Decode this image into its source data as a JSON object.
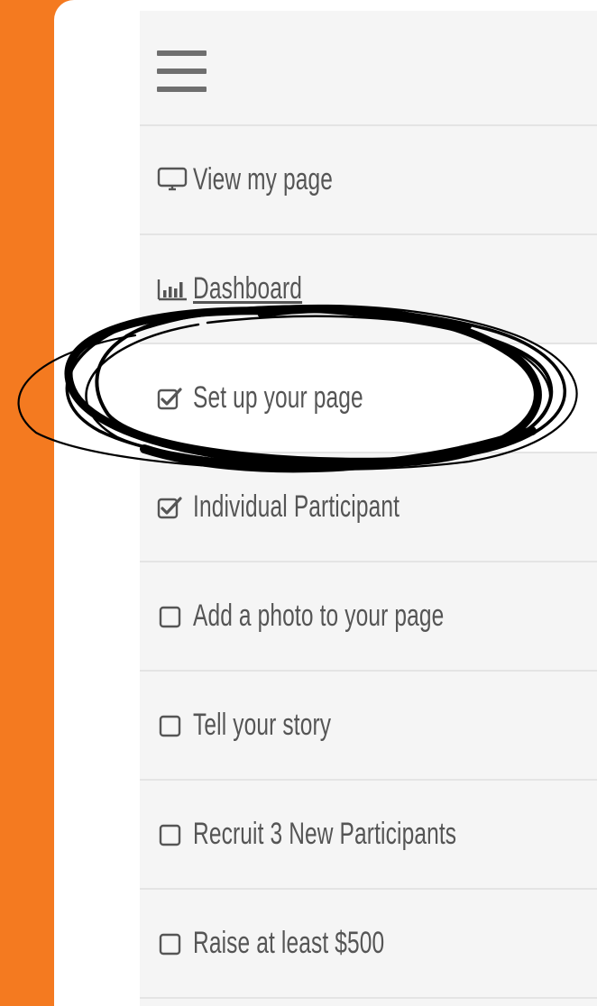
{
  "colors": {
    "accent_orange": "#f47a20",
    "menu_bg": "#f5f5f5",
    "active_bg": "#ffffff",
    "text": "#555555",
    "divider": "#e4e4e4"
  },
  "menu": {
    "toggle_icon": "hamburger-icon",
    "items": [
      {
        "label": "View my page",
        "icon": "monitor-icon"
      },
      {
        "label": "Dashboard",
        "icon": "bar-chart-icon"
      },
      {
        "label": "Set up your page",
        "icon": "checked-box-icon",
        "checked": true,
        "active": true,
        "circled": true
      },
      {
        "label": "Individual Participant",
        "icon": "checked-box-icon",
        "checked": true
      },
      {
        "label": "Add a photo to your page",
        "icon": "empty-checkbox-icon",
        "checked": false
      },
      {
        "label": "Tell your story",
        "icon": "empty-checkbox-icon",
        "checked": false
      },
      {
        "label": "Recruit 3 New Participants",
        "icon": "empty-checkbox-icon",
        "checked": false
      },
      {
        "label": "Raise at least $500",
        "icon": "empty-checkbox-icon",
        "checked": false
      }
    ]
  }
}
